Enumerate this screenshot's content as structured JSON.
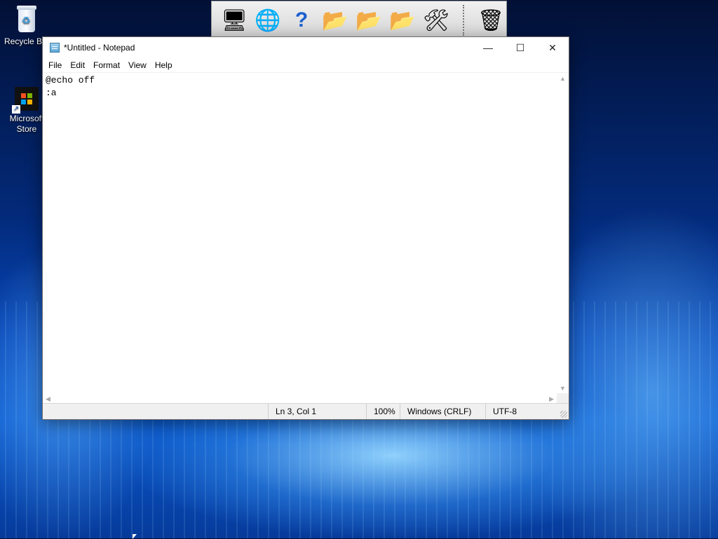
{
  "desktop": {
    "icons": [
      {
        "label": "Recycle Bin",
        "icon": "recycle-bin-icon"
      },
      {
        "label": "Microsoft Store",
        "icon": "microsoft-store-icon"
      }
    ]
  },
  "toolbar": {
    "buttons": [
      {
        "icon": "monitor-icon",
        "glyph": "🖥"
      },
      {
        "icon": "globe-internet-icon",
        "glyph": "🌐"
      },
      {
        "icon": "help-question-icon",
        "glyph": "❓"
      },
      {
        "icon": "folder-icon",
        "glyph": "📂"
      },
      {
        "icon": "folder-music-icon",
        "glyph": "📂"
      },
      {
        "icon": "folder-video-icon",
        "glyph": "📂"
      },
      {
        "icon": "tools-icon",
        "glyph": "🛠"
      },
      {
        "icon": "recycle-bin-icon",
        "glyph": "🗑"
      }
    ]
  },
  "window": {
    "title": "*Untitled - Notepad",
    "controls": {
      "minimize": "—",
      "maximize": "☐",
      "close": "✕"
    }
  },
  "menu": {
    "items": [
      "File",
      "Edit",
      "Format",
      "View",
      "Help"
    ]
  },
  "editor": {
    "content": "@echo off\n:a\n"
  },
  "status": {
    "position": "Ln 3, Col 1",
    "zoom": "100%",
    "line_ending": "Windows (CRLF)",
    "encoding": "UTF-8"
  },
  "colors": {
    "store_red": "#f25022",
    "store_green": "#7fba00",
    "store_blue": "#00a4ef",
    "store_yellow": "#ffb900"
  }
}
